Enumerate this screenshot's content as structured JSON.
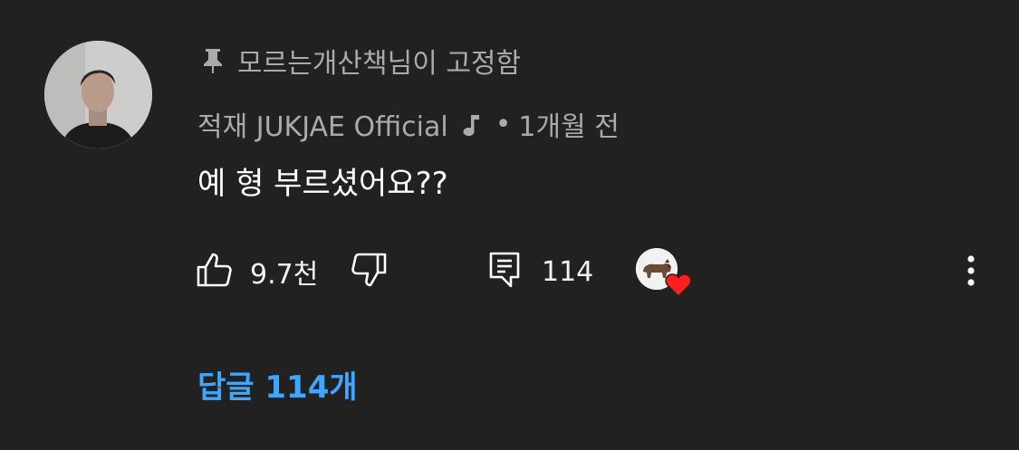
{
  "comment": {
    "pinned_text": "모르는개산책님이 고정함",
    "author": "적재 JUKJAE Official",
    "separator": "•",
    "timestamp": "1개월 전",
    "text": "예 형 부르셨어요??",
    "like_count": "9.7천",
    "reply_count": "114",
    "replies_link": "답글 114개"
  },
  "icons": {
    "pin": "pin-icon",
    "music": "music-note-icon",
    "like": "thumbs-up-icon",
    "dislike": "thumbs-down-icon",
    "reply": "comment-icon",
    "heart": "heart-icon",
    "more": "more-vertical-icon"
  },
  "colors": {
    "background": "#212121",
    "secondary_text": "#aaaaaa",
    "link": "#3ea6ff",
    "heart": "#ff1f1f"
  }
}
